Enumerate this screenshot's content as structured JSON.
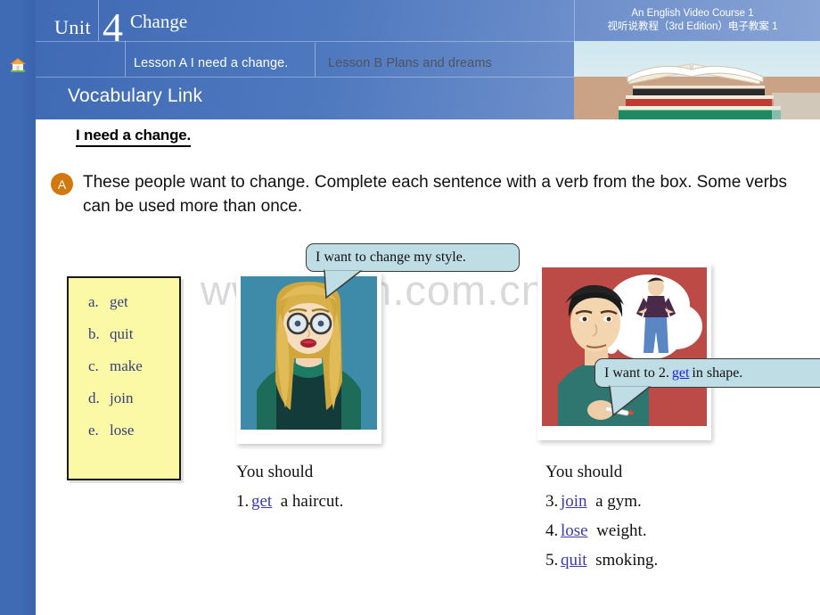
{
  "sidebar": {
    "home_icon": "home-icon"
  },
  "header": {
    "unit_word": "Unit",
    "unit_number": "4",
    "unit_title": "Change",
    "tabs": [
      {
        "label": "Lesson A  I need a change.",
        "active": true
      },
      {
        "label": "Lesson B Plans and dreams",
        "active": false
      }
    ],
    "section_title": "Vocabulary Link",
    "course_line_en": "An English Video Course 1",
    "course_line_cn": "视听说教程（3rd Edition）电子教案 1",
    "book_photo": "stack-of-books-photo",
    "accent_blue": "#3f6ab4"
  },
  "content": {
    "lesson_heading": "I need a change.",
    "badge": "A",
    "instruction": "These people want to change. Complete each sentence with a verb from the box. Some verbs can be used more than once.",
    "watermark": "www.zixin.com.cn"
  },
  "verb_box": {
    "accent": "#fbf8a6",
    "items": [
      {
        "letter": "a.",
        "verb": "get"
      },
      {
        "letter": "b.",
        "verb": "quit"
      },
      {
        "letter": "c.",
        "verb": "make"
      },
      {
        "letter": "d.",
        "verb": "join"
      },
      {
        "letter": "e.",
        "verb": "lose"
      }
    ]
  },
  "photos": [
    {
      "name": "woman-with-glasses-illustration",
      "alt": "Illustration of a blonde woman with glasses in a green turtleneck on a teal background"
    },
    {
      "name": "man-smoking-illustration",
      "alt": "Illustration of a man smoking with a thought bubble of a fit man, red background"
    }
  ],
  "bubbles": [
    {
      "name": "speech-bubble-style",
      "pre": "I want to change my style.",
      "answer": "",
      "post": ""
    },
    {
      "name": "speech-bubble-shape",
      "pre": "I want to 2.",
      "answer": "get",
      "post": "in shape."
    }
  ],
  "answers": {
    "left": {
      "lead": "You should",
      "items": [
        {
          "num": "1.",
          "answer": "get",
          "rest": "a haircut."
        }
      ]
    },
    "right": {
      "lead": "You should",
      "items": [
        {
          "num": "3.",
          "answer": "join",
          "rest": "a gym."
        },
        {
          "num": "4.",
          "answer": "lose",
          "rest": "weight."
        },
        {
          "num": "5.",
          "answer": "quit",
          "rest": "smoking."
        }
      ]
    },
    "answer_color": "#3a3ab0"
  }
}
